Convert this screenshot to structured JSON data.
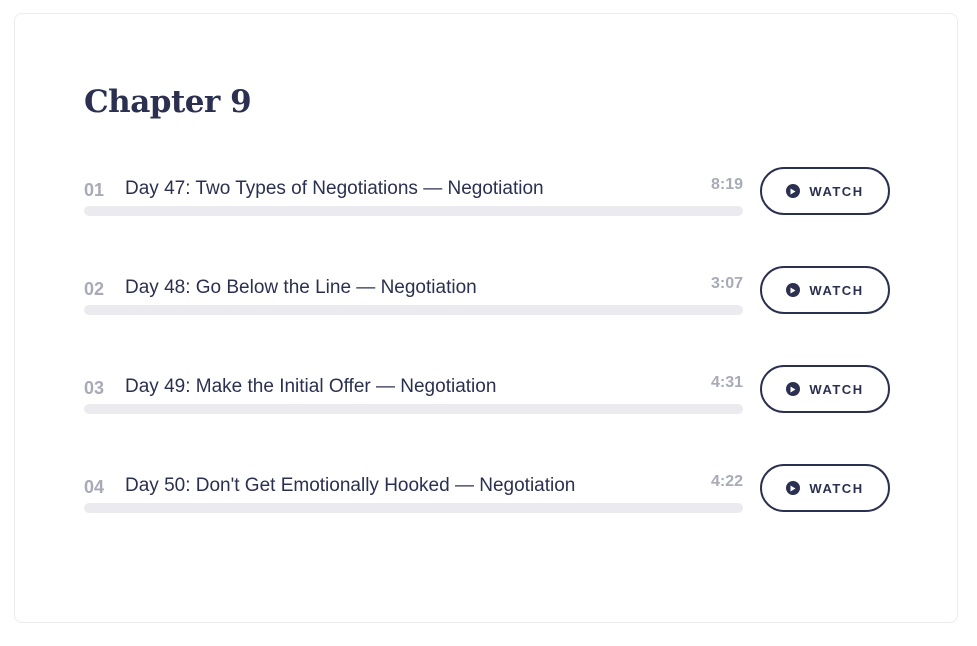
{
  "chapter": {
    "title": "Chapter 9"
  },
  "lessons": [
    {
      "number": "01",
      "title": "Day 47: Two Types of Negotiations — Negotiation",
      "duration": "8:19",
      "progress": 0,
      "watch_label": "WATCH"
    },
    {
      "number": "02",
      "title": "Day 48: Go Below the Line — Negotiation",
      "duration": "3:07",
      "progress": 0,
      "watch_label": "WATCH"
    },
    {
      "number": "03",
      "title": "Day 49: Make the Initial Offer — Negotiation",
      "duration": "4:31",
      "progress": 0,
      "watch_label": "WATCH"
    },
    {
      "number": "04",
      "title": "Day 50: Don't Get Emotionally Hooked — Negotiation",
      "duration": "4:22",
      "progress": 0,
      "watch_label": "WATCH"
    }
  ],
  "icons": {
    "watch": "play-circle-icon"
  },
  "colors": {
    "primary": "#2b3050",
    "muted": "#a8aab8",
    "track": "#ebebef"
  }
}
